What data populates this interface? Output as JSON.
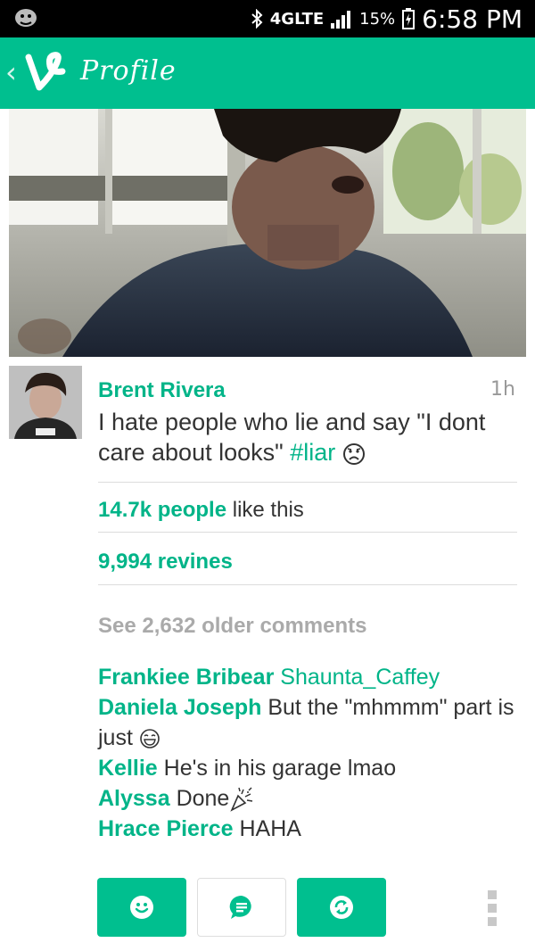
{
  "status_bar": {
    "network": "4GLTE",
    "battery": "15%",
    "time": "6:58 PM"
  },
  "app_bar": {
    "title": "Profile",
    "back_glyph": "‹"
  },
  "post": {
    "author": "Brent Rivera",
    "time_ago": "1h",
    "caption_text": "I hate people who lie and say \"I dont care about looks\" ",
    "hashtag": "#liar",
    "likes_count": "14.7k people",
    "likes_suffix": " like this",
    "revines": "9,994 revines",
    "older_comments": "See 2,632 older comments"
  },
  "comments": [
    {
      "name": "Frankiee Bribear",
      "text": "",
      "mention": "Shaunta_Caffey"
    },
    {
      "name": "Daniela Joseph",
      "text": " But the \"mhmmm\" part is just ",
      "mention": ""
    },
    {
      "name": "Kellie",
      "text": " He's in his garage lmao",
      "mention": ""
    },
    {
      "name": "Alyssa",
      "text": " Done",
      "mention": ""
    },
    {
      "name": "Hrace Pierce",
      "text": " HAHA",
      "mention": ""
    }
  ],
  "actions": [
    {
      "icon": "smiley-icon"
    },
    {
      "icon": "comment-icon"
    },
    {
      "icon": "revine-icon"
    }
  ],
  "colors": {
    "accent": "#00bf8f",
    "accent_text": "#00b488"
  }
}
